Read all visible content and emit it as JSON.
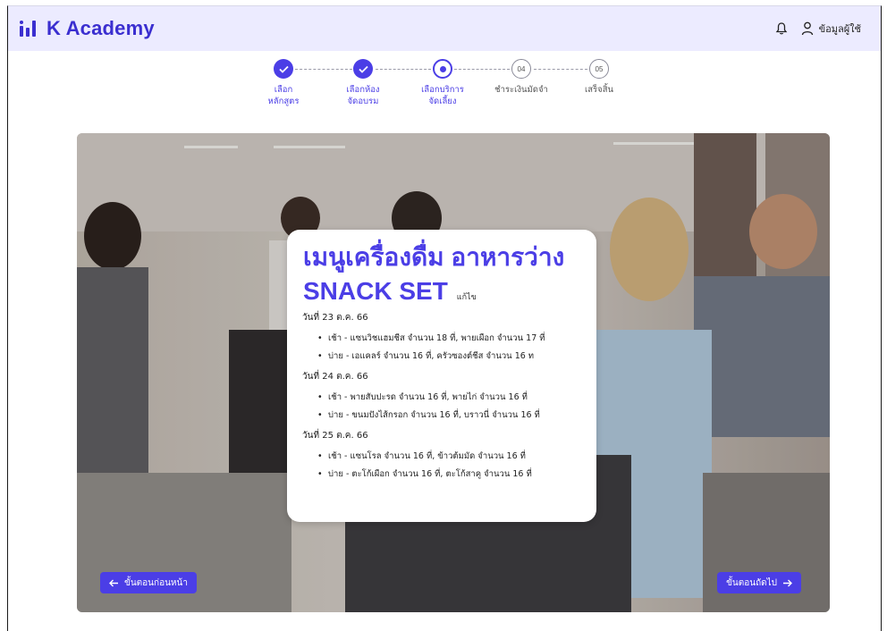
{
  "header": {
    "brand": "K Academy",
    "user_label": "ข้อมูลผู้ใช้",
    "accent": "#3b2fd0",
    "background": "#ecebff",
    "icons": [
      "logo-bars-icon",
      "bell-icon",
      "user-icon"
    ]
  },
  "stepper": {
    "steps": [
      {
        "label": "เลือก\nหลักสูตร",
        "status": "done"
      },
      {
        "label": "เลือกห้อง\nจัดอบรม",
        "status": "done"
      },
      {
        "label": "เลือกบริการ\nจัดเลี้ยง",
        "status": "current"
      },
      {
        "label": "ชำระเงินมัดจำ",
        "status": "todo",
        "number": "04"
      },
      {
        "label": "เสร็จสิ้น",
        "status": "todo",
        "number": "05"
      }
    ]
  },
  "menu_card": {
    "title": "เมนูเครื่องดื่ม อาหารว่าง",
    "subtitle": "SNACK SET",
    "edit_label": "แก้ไข",
    "days": [
      {
        "date": "วันที่ 23 ต.ค. 66",
        "items": [
          "เช้า - แซนวิชแฮมชีส จำนวน 18 ที่, พายเผือก จำนวน 17 ที่",
          "บ่าย - เอแคลร์ จำนวน 16 ที่,  ครัวซองต์ชีส จำนวน 16 ท"
        ]
      },
      {
        "date": "วันที่ 24 ต.ค. 66",
        "items": [
          "เช้า - พายสับปะรด จำนวน 16 ที่, พายไก่ จำนวน 16 ที่",
          "บ่าย - ขนมปังไส้กรอก จำนวน 16 ที่, บราวนี่ จำนวน 16 ที่"
        ]
      },
      {
        "date": "วันที่ 25 ต.ค. 66",
        "items": [
          "เช้า - แซนโรล จำนวน 16 ที่, ข้าวต้มมัด จำนวน 16 ที่",
          "บ่าย - ตะโก้เผือก จำนวน 16 ที่, ตะโก้สาคู  จำนวน 16 ที่"
        ]
      }
    ]
  },
  "nav": {
    "prev_label": "ขั้นตอนก่อนหน้า",
    "next_label": "ขั้นตอนถัดไป",
    "button_color": "#4b3ee6"
  }
}
